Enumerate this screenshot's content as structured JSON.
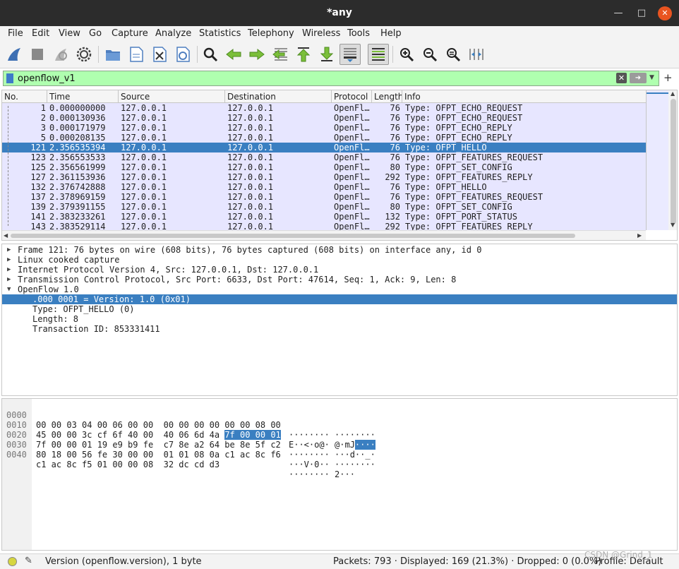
{
  "window": {
    "title": "*any"
  },
  "menu": [
    "File",
    "Edit",
    "View",
    "Go",
    "Capture",
    "Analyze",
    "Statistics",
    "Telephony",
    "Wireless",
    "Tools",
    "Help"
  ],
  "filter": {
    "value": "openflow_v1"
  },
  "packet_list": {
    "columns": [
      "No.",
      "Time",
      "Source",
      "Destination",
      "Protocol",
      "Length",
      "Info"
    ],
    "rows": [
      {
        "no": "1",
        "time": "0.000000000",
        "src": "127.0.0.1",
        "dst": "127.0.0.1",
        "proto": "OpenFl…",
        "len": "76",
        "info": "Type: OFPT_ECHO_REQUEST"
      },
      {
        "no": "2",
        "time": "0.000130936",
        "src": "127.0.0.1",
        "dst": "127.0.0.1",
        "proto": "OpenFl…",
        "len": "76",
        "info": "Type: OFPT_ECHO_REQUEST"
      },
      {
        "no": "3",
        "time": "0.000171979",
        "src": "127.0.0.1",
        "dst": "127.0.0.1",
        "proto": "OpenFl…",
        "len": "76",
        "info": "Type: OFPT_ECHO_REPLY"
      },
      {
        "no": "5",
        "time": "0.000208135",
        "src": "127.0.0.1",
        "dst": "127.0.0.1",
        "proto": "OpenFl…",
        "len": "76",
        "info": "Type: OFPT_ECHO_REPLY"
      },
      {
        "no": "121",
        "time": "2.356535394",
        "src": "127.0.0.1",
        "dst": "127.0.0.1",
        "proto": "OpenFl…",
        "len": "76",
        "info": "Type: OFPT_HELLO"
      },
      {
        "no": "123",
        "time": "2.356553533",
        "src": "127.0.0.1",
        "dst": "127.0.0.1",
        "proto": "OpenFl…",
        "len": "76",
        "info": "Type: OFPT_FEATURES_REQUEST"
      },
      {
        "no": "125",
        "time": "2.356561999",
        "src": "127.0.0.1",
        "dst": "127.0.0.1",
        "proto": "OpenFl…",
        "len": "80",
        "info": "Type: OFPT_SET_CONFIG"
      },
      {
        "no": "127",
        "time": "2.361153936",
        "src": "127.0.0.1",
        "dst": "127.0.0.1",
        "proto": "OpenFl…",
        "len": "292",
        "info": "Type: OFPT_FEATURES_REPLY"
      },
      {
        "no": "132",
        "time": "2.376742888",
        "src": "127.0.0.1",
        "dst": "127.0.0.1",
        "proto": "OpenFl…",
        "len": "76",
        "info": "Type: OFPT_HELLO"
      },
      {
        "no": "137",
        "time": "2.378969159",
        "src": "127.0.0.1",
        "dst": "127.0.0.1",
        "proto": "OpenFl…",
        "len": "76",
        "info": "Type: OFPT_FEATURES_REQUEST"
      },
      {
        "no": "139",
        "time": "2.379391155",
        "src": "127.0.0.1",
        "dst": "127.0.0.1",
        "proto": "OpenFl…",
        "len": "80",
        "info": "Type: OFPT_SET_CONFIG"
      },
      {
        "no": "141",
        "time": "2.383233261",
        "src": "127.0.0.1",
        "dst": "127.0.0.1",
        "proto": "OpenFl…",
        "len": "132",
        "info": "Type: OFPT_PORT_STATUS"
      },
      {
        "no": "143",
        "time": "2.383529114",
        "src": "127.0.0.1",
        "dst": "127.0.0.1",
        "proto": "OpenFl…",
        "len": "292",
        "info": "Type: OFPT_FEATURES_REPLY"
      }
    ],
    "selected_no": "121"
  },
  "details": [
    {
      "text": "Frame 121: 76 bytes on wire (608 bits), 76 bytes captured (608 bits) on interface any, id 0",
      "expander": "collapsed"
    },
    {
      "text": "Linux cooked capture",
      "expander": "collapsed"
    },
    {
      "text": "Internet Protocol Version 4, Src: 127.0.0.1, Dst: 127.0.0.1",
      "expander": "collapsed"
    },
    {
      "text": "Transmission Control Protocol, Src Port: 6633, Dst Port: 47614, Seq: 1, Ack: 9, Len: 8",
      "expander": "collapsed"
    },
    {
      "text": "OpenFlow 1.0",
      "expander": "expanded"
    },
    {
      "text": ".000 0001 = Version: 1.0 (0x01)",
      "expander": "",
      "selected": true
    },
    {
      "text": "Type: OFPT_HELLO (0)",
      "expander": ""
    },
    {
      "text": "Length: 8",
      "expander": ""
    },
    {
      "text": "Transaction ID: 853331411",
      "expander": ""
    }
  ],
  "hex": [
    {
      "offset": "0000",
      "bytes": "00 00 03 04 00 06 00 00  00 00 00 00 00 00 08 00",
      "ascii": "········ ········"
    },
    {
      "offset": "0010",
      "bytes": "45 00 00 3c cf 6f 40 00  40 06 6d 4a ",
      "bytes_hl": "7f 00 00 01",
      "ascii": "E··<·o@· @·mJ",
      "ascii_hl": "····"
    },
    {
      "offset": "0020",
      "bytes": "7f 00 00 01 19 e9 b9 fe  c7 8e a2 64 be 8e 5f c2",
      "ascii": "········ ···d··_·"
    },
    {
      "offset": "0030",
      "bytes": "80 18 00 56 fe 30 00 00  01 01 08 0a c1 ac 8c f6",
      "ascii": "···V·0·· ········"
    },
    {
      "offset": "0040",
      "bytes": "c1 ac 8c f5 01 00 00 08  32 dc cd d3",
      "ascii": "········ 2···"
    }
  ],
  "status": {
    "field": "Version (openflow.version), 1 byte",
    "counts": "Packets: 793 · Displayed: 169 (21.3%) · Dropped: 0 (0.0%)",
    "profile": "Profile: Default",
    "watermark": "CSDN @Grind_1"
  },
  "icons": [
    "shark-fin-start-icon",
    "stop-icon",
    "restart-icon",
    "options-gear-icon",
    "open-folder-icon",
    "save-file-icon",
    "close-file-icon",
    "reload-icon",
    "find-icon",
    "back-icon",
    "forward-icon",
    "goto-packet-icon",
    "first-packet-icon",
    "last-packet-icon",
    "autoscroll-icon",
    "colorize-icon",
    "zoom-in-icon",
    "zoom-out-icon",
    "zoom-normal-icon",
    "resize-columns-icon"
  ],
  "colors": {
    "filter_ok": "#afffaf",
    "row_bg": "#e7e6ff",
    "selection": "#3a7fc1",
    "close_button": "#e95420"
  }
}
